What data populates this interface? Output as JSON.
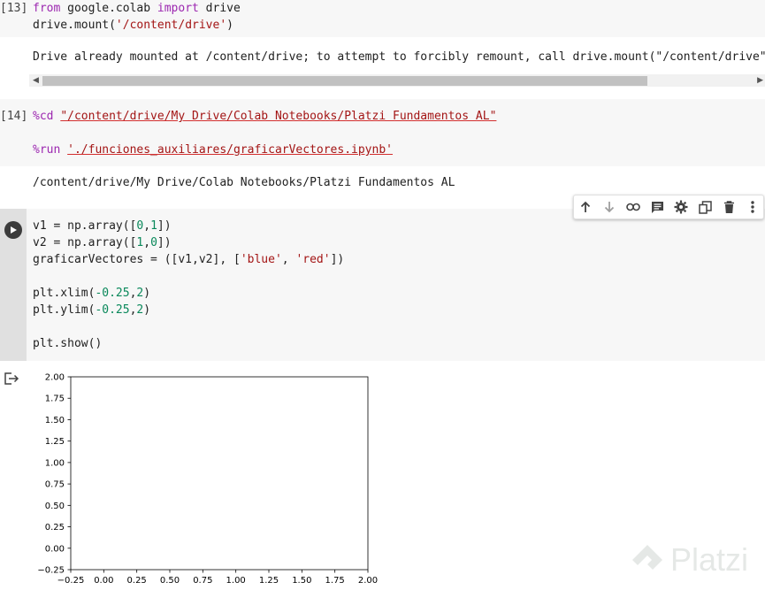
{
  "cell1": {
    "exec_count": "[13]",
    "line1": {
      "kw1": "from",
      "mid": " google.colab ",
      "kw2": "import",
      "rest": " drive"
    },
    "line2": {
      "pre": "drive.mount(",
      "str": "'/content/drive'",
      "post": ")"
    },
    "output": "Drive already mounted at /content/drive; to attempt to forcibly remount, call drive.mount(\"/content/drive\","
  },
  "cell2": {
    "exec_count": "[14]",
    "line1": {
      "kw": "%cd",
      "str": "\"/content/drive/My Drive/Colab Notebooks/Platzi Fundamentos AL\""
    },
    "line2": {
      "kw": "%run",
      "str": "'./funciones_auxiliares/graficarVectores.ipynb'"
    },
    "output": "/content/drive/My Drive/Colab Notebooks/Platzi Fundamentos AL"
  },
  "cell3": {
    "l1": {
      "a": "v1 = np.array([",
      "n1": "0",
      "c": ",",
      "n2": "1",
      "b": "])"
    },
    "l2": {
      "a": "v2 = np.array([",
      "n1": "1",
      "c": ",",
      "n2": "0",
      "b": "])"
    },
    "l3": {
      "a": "graficarVectores = ([v1,v2], [",
      "s1": "'blue'",
      "c": ", ",
      "s2": "'red'",
      "b": "])"
    },
    "l4": {
      "a": "plt.xlim(",
      "n1": "-0.25",
      "c": ",",
      "n2": "2",
      "b": ")"
    },
    "l5": {
      "a": "plt.ylim(",
      "n1": "-0.25",
      "c": ",",
      "n2": "2",
      "b": ")"
    },
    "l6": "plt.show()"
  },
  "toolbar_icons": [
    "arrow-up-icon",
    "arrow-down-icon",
    "link-icon",
    "comment-icon",
    "gear-icon",
    "mirror-cell-icon",
    "trash-icon",
    "more-vert-icon"
  ],
  "watermark": "Platzi",
  "chart_data": {
    "type": "line",
    "title": "",
    "xlabel": "",
    "ylabel": "",
    "xlim": [
      -0.25,
      2.0
    ],
    "ylim": [
      -0.25,
      2.0
    ],
    "xticks": [
      "−0.25",
      "0.00",
      "0.25",
      "0.50",
      "0.75",
      "1.00",
      "1.25",
      "1.50",
      "1.75",
      "2.00"
    ],
    "yticks": [
      "−0.25",
      "0.00",
      "0.25",
      "0.50",
      "0.75",
      "1.00",
      "1.25",
      "1.50",
      "1.75",
      "2.00"
    ],
    "series": [],
    "grid": false
  }
}
